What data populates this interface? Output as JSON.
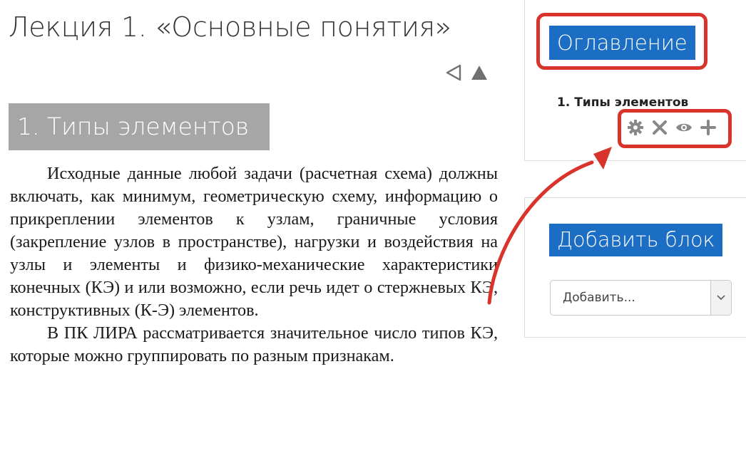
{
  "lesson": {
    "title": "Лекция 1. «Основные понятия»",
    "nav": {
      "prev_icon": "triangle-left-outline-icon",
      "up_icon": "triangle-up-icon"
    },
    "section_heading": "1. Типы элементов",
    "paragraphs": [
      "Исходные данные любой задачи (расчетная схема) должны включать, как минимум, геометрическую схему, информацию о прикреплении элементов к узлам, граничные условия (закрепление узлов в пространстве), нагрузки и воздействия на узлы и элементы и физико-механические характеристики конечных (КЭ) и или возможно, если речь идет о стержневых КЭ, конструктивных (К-Э) элементов.",
      "В ПК ЛИРА рассматривается значительное число типов КЭ, которые можно группировать по разным признакам."
    ]
  },
  "toc_block": {
    "title": "Оглавление",
    "items": [
      {
        "label": "1. Типы элементов"
      }
    ],
    "actions": [
      "gear-icon",
      "close-icon",
      "eye-icon",
      "plus-icon"
    ]
  },
  "add_block": {
    "title": "Добавить блок",
    "select_value": "Добавить..."
  },
  "colors": {
    "accent_blue": "#1c6ec4",
    "heading_gray": "#a6a6a6",
    "highlight_red": "#d9342b",
    "icon_gray": "#888888"
  }
}
